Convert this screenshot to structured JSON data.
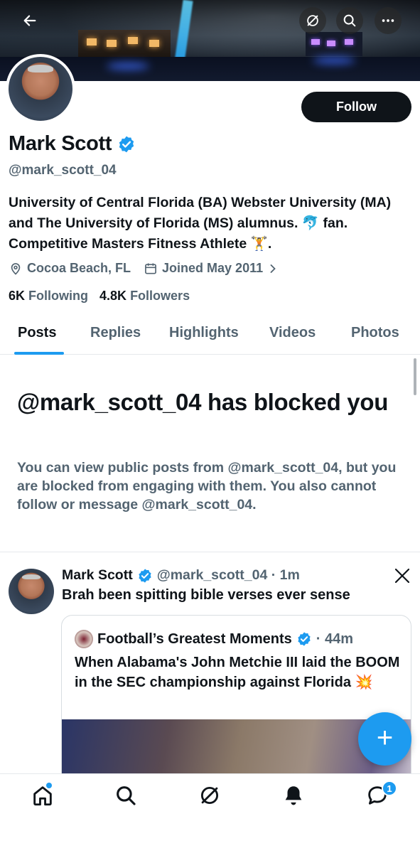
{
  "profile": {
    "name": "Mark Scott",
    "handle": "@mark_scott_04",
    "bio": "University of Central Florida (BA) Webster University (MA) and The University of Florida (MS) alumnus. 🐬 fan. Competitive Masters Fitness Athlete 🏋️.",
    "location": "Cocoa Beach, FL",
    "joined": "Joined May 2011",
    "following_count": "6K",
    "following_label": "Following",
    "followers_count": "4.8K",
    "followers_label": "Followers",
    "follow_label": "Follow"
  },
  "tabs": [
    "Posts",
    "Replies",
    "Highlights",
    "Videos",
    "Photos"
  ],
  "active_tab": "Posts",
  "blocked": {
    "title": "@mark_scott_04 has blocked you",
    "description": "You can view public posts from @mark_scott_04, but you are blocked from engaging with them. You also cannot follow or message @mark_scott_04."
  },
  "post": {
    "author": "Mark Scott",
    "handle_time": "@mark_scott_04 · 1m",
    "text": "Brah been spitting bible verses ever sense",
    "quote": {
      "author": "Football’s Greatest Moments",
      "time": "· 44m",
      "text": "When Alabama's John Metchie III laid the BOOM in the SEC championship against Florida 💥"
    }
  },
  "bottom_nav": {
    "items": [
      "home-icon",
      "search-icon",
      "grok-icon",
      "notifications-icon",
      "messages-icon"
    ],
    "messages_badge": "1"
  },
  "colors": {
    "accent": "#1d9bf0",
    "text": "#0f1419",
    "secondary_text": "#536471",
    "follow_button": "#0f1419"
  }
}
